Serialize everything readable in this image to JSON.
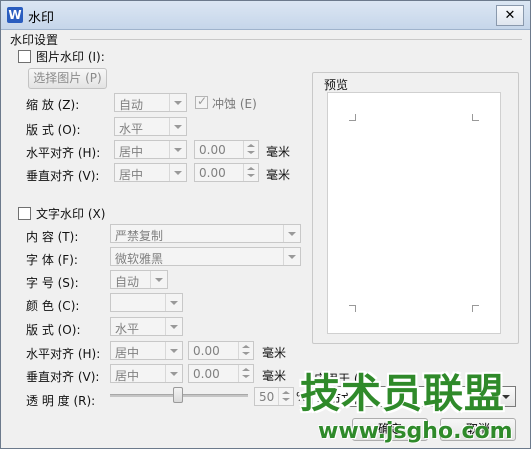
{
  "window": {
    "title": "水印",
    "app_icon": "W",
    "close": "✕"
  },
  "group": {
    "label": "水印设置"
  },
  "picture": {
    "checkbox_label": "图片水印 (I):",
    "select_button": "选择图片 (P)",
    "scale_label": "缩    放 (Z):",
    "scale_value": "自动",
    "washout_label": "冲蚀 (E)",
    "layout_label": "版    式 (O):",
    "layout_value": "水平",
    "halign_label": "水平对齐 (H):",
    "halign_value": "居中",
    "halign_offset": "0.00",
    "valign_label": "垂直对齐 (V):",
    "valign_value": "居中",
    "valign_offset": "0.00",
    "unit": "毫米"
  },
  "text": {
    "checkbox_label": "文字水印 (X)",
    "content_label": "内    容 (T):",
    "content_value": "严禁复制",
    "font_label": "字    体 (F):",
    "font_value": "微软雅黑",
    "size_label": "字    号 (S):",
    "size_value": "自动",
    "color_label": "颜    色 (C):",
    "color_value": "",
    "layout_label": "版    式 (O):",
    "layout_value": "水平",
    "halign_label": "水平对齐 (H):",
    "halign_value": "居中",
    "halign_offset": "0.00",
    "valign_label": "垂直对齐 (V):",
    "valign_value": "居中",
    "valign_offset": "0.00",
    "unit": "毫米",
    "transparency_label": "透 明 度 (R):",
    "transparency_value": "50",
    "transparency_unit": "%",
    "transparency_fraction": 0.5
  },
  "preview": {
    "label": "预览"
  },
  "apply": {
    "label": "应用于 (Y):",
    "value": "本节文档"
  },
  "buttons": {
    "ok": "确定",
    "cancel": "取消"
  },
  "overlay": {
    "brand": "技术员联盟",
    "url": "www.jsgho.com"
  }
}
